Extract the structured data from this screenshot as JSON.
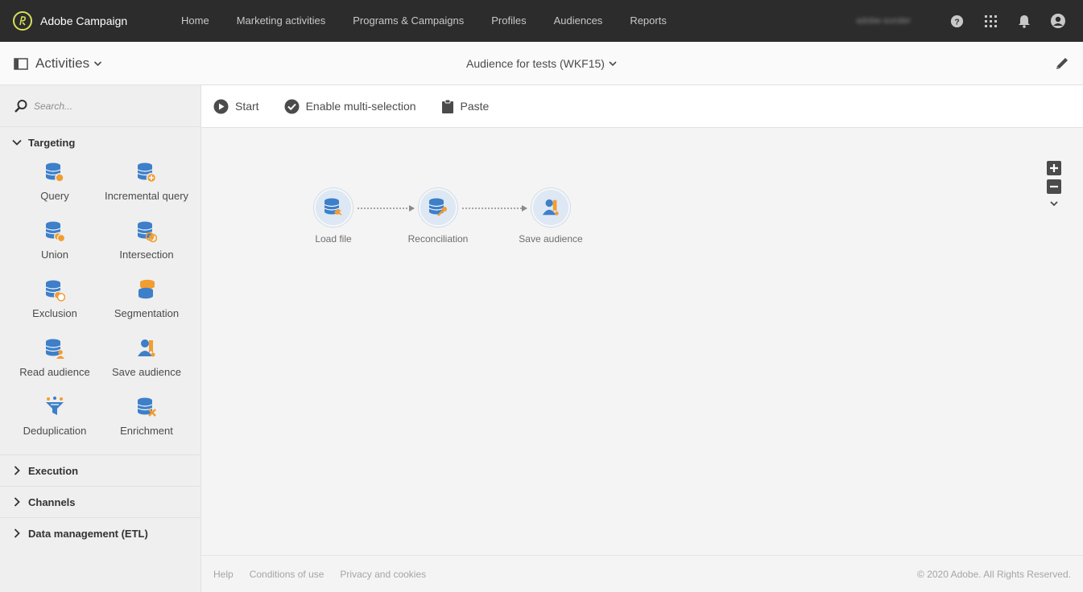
{
  "app": {
    "brand_name": "Adobe Campaign",
    "brand_color": "#d6e05a",
    "nav": [
      {
        "label": "Home"
      },
      {
        "label": "Marketing activities"
      },
      {
        "label": "Programs & Campaigns"
      },
      {
        "label": "Profiles"
      },
      {
        "label": "Audiences"
      },
      {
        "label": "Reports"
      }
    ],
    "user_name": "adobe-sunder",
    "icons": [
      "help-icon",
      "apps-grid-icon",
      "bell-icon",
      "user-avatar-icon"
    ]
  },
  "subheader": {
    "panel_label": "Activities",
    "workflow_title": "Audience for tests (WKF15)"
  },
  "sidebar": {
    "search_placeholder": "Search...",
    "sections": [
      {
        "label": "Targeting",
        "expanded": true,
        "items": [
          {
            "label": "Query",
            "icon": "query-icon"
          },
          {
            "label": "Incremental query",
            "icon": "incremental-query-icon"
          },
          {
            "label": "Union",
            "icon": "union-icon"
          },
          {
            "label": "Intersection",
            "icon": "intersection-icon"
          },
          {
            "label": "Exclusion",
            "icon": "exclusion-icon"
          },
          {
            "label": "Segmentation",
            "icon": "segmentation-icon"
          },
          {
            "label": "Read audience",
            "icon": "read-audience-icon"
          },
          {
            "label": "Save audience",
            "icon": "save-audience-icon"
          },
          {
            "label": "Deduplication",
            "icon": "deduplication-icon"
          },
          {
            "label": "Enrichment",
            "icon": "enrichment-icon"
          }
        ]
      },
      {
        "label": "Execution",
        "expanded": false
      },
      {
        "label": "Channels",
        "expanded": false
      },
      {
        "label": "Data management (ETL)",
        "expanded": false
      }
    ]
  },
  "toolbar": {
    "start_label": "Start",
    "multi_select_label": "Enable multi-selection",
    "paste_label": "Paste"
  },
  "workflow": {
    "nodes": [
      {
        "label": "Load file",
        "icon": "load-file-icon"
      },
      {
        "label": "Reconciliation",
        "icon": "reconciliation-icon"
      },
      {
        "label": "Save audience",
        "icon": "save-audience-icon"
      }
    ]
  },
  "footer": {
    "links": [
      {
        "label": "Help"
      },
      {
        "label": "Conditions of use"
      },
      {
        "label": "Privacy and cookies"
      }
    ],
    "copyright": "© 2020 Adobe. All Rights Reserved."
  },
  "colors": {
    "topbar": "#2c2c2c",
    "icon_blue": "#3d7fc9",
    "icon_orange": "#f29d2f",
    "node_bg": "#dde8f4"
  }
}
